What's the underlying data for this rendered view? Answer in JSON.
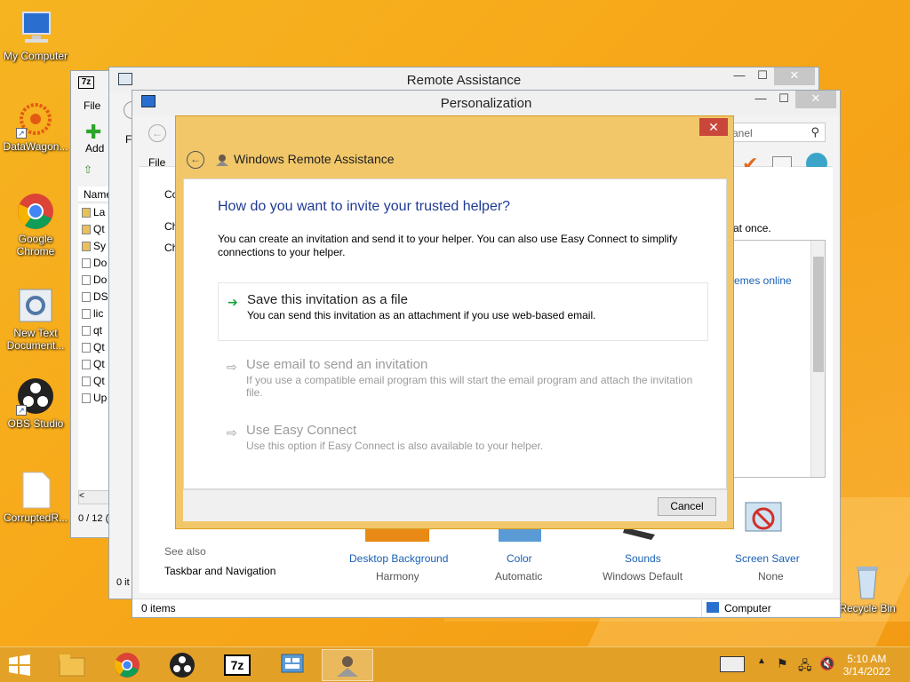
{
  "desktop": {
    "icons": [
      {
        "label": "My Computer"
      },
      {
        "label": "DataWagon..."
      },
      {
        "label": "Google Chrome"
      },
      {
        "label": "New Text Document..."
      },
      {
        "label": "OBS Studio"
      },
      {
        "label": "CorruptedR..."
      },
      {
        "label": "Recycle Bin"
      }
    ]
  },
  "win7z": {
    "menu": "File",
    "add": "Add",
    "name_header": "Name",
    "files": [
      "La",
      "Qt",
      "Sy",
      "Do",
      "Do",
      "DS",
      "lic",
      "qt",
      "Qt",
      "Qt",
      "Qt",
      "Up"
    ],
    "status": "0 / 12 ("
  },
  "remote_assistance": {
    "title": "Remote Assistance",
    "status": "0 it"
  },
  "personalization": {
    "title": "Personalization",
    "menu_file": "File",
    "search_placeholder": "anel",
    "text_co": "Co",
    "text_ch1": "Ch",
    "text_ch2": "Ch",
    "text_at_once": "at once.",
    "themes_online": "emes online",
    "see_also": "See also",
    "taskbar_nav": "Taskbar and Navigation",
    "items": [
      {
        "label": "Desktop Background",
        "value": "Harmony"
      },
      {
        "label": "Color",
        "value": "Automatic"
      },
      {
        "label": "Sounds",
        "value": "Windows Default"
      },
      {
        "label": "Screen Saver",
        "value": "None"
      }
    ],
    "status_items": "0 items",
    "status_computer": "Computer"
  },
  "dialog": {
    "title": "Windows Remote Assistance",
    "question": "How do you want to invite your trusted helper?",
    "intro": "You can create an invitation and send it to your helper. You can also use Easy Connect to simplify connections to your helper.",
    "options": [
      {
        "title": "Save this invitation as a file",
        "desc": "You can send this invitation as an attachment if you use web-based email."
      },
      {
        "title": "Use email to send an invitation",
        "desc": "If you use a compatible email program this will start the email program and attach the invitation file."
      },
      {
        "title": "Use Easy Connect",
        "desc": "Use this option if Easy Connect is also available to your helper."
      }
    ],
    "cancel": "Cancel"
  },
  "taskbar": {
    "clock_time": "5:10 AM",
    "clock_date": "3/14/2022"
  },
  "colors": {
    "accent_blue": "#1f3a93",
    "close_red": "#c9463a",
    "dialog_frame": "#f1c76a"
  }
}
